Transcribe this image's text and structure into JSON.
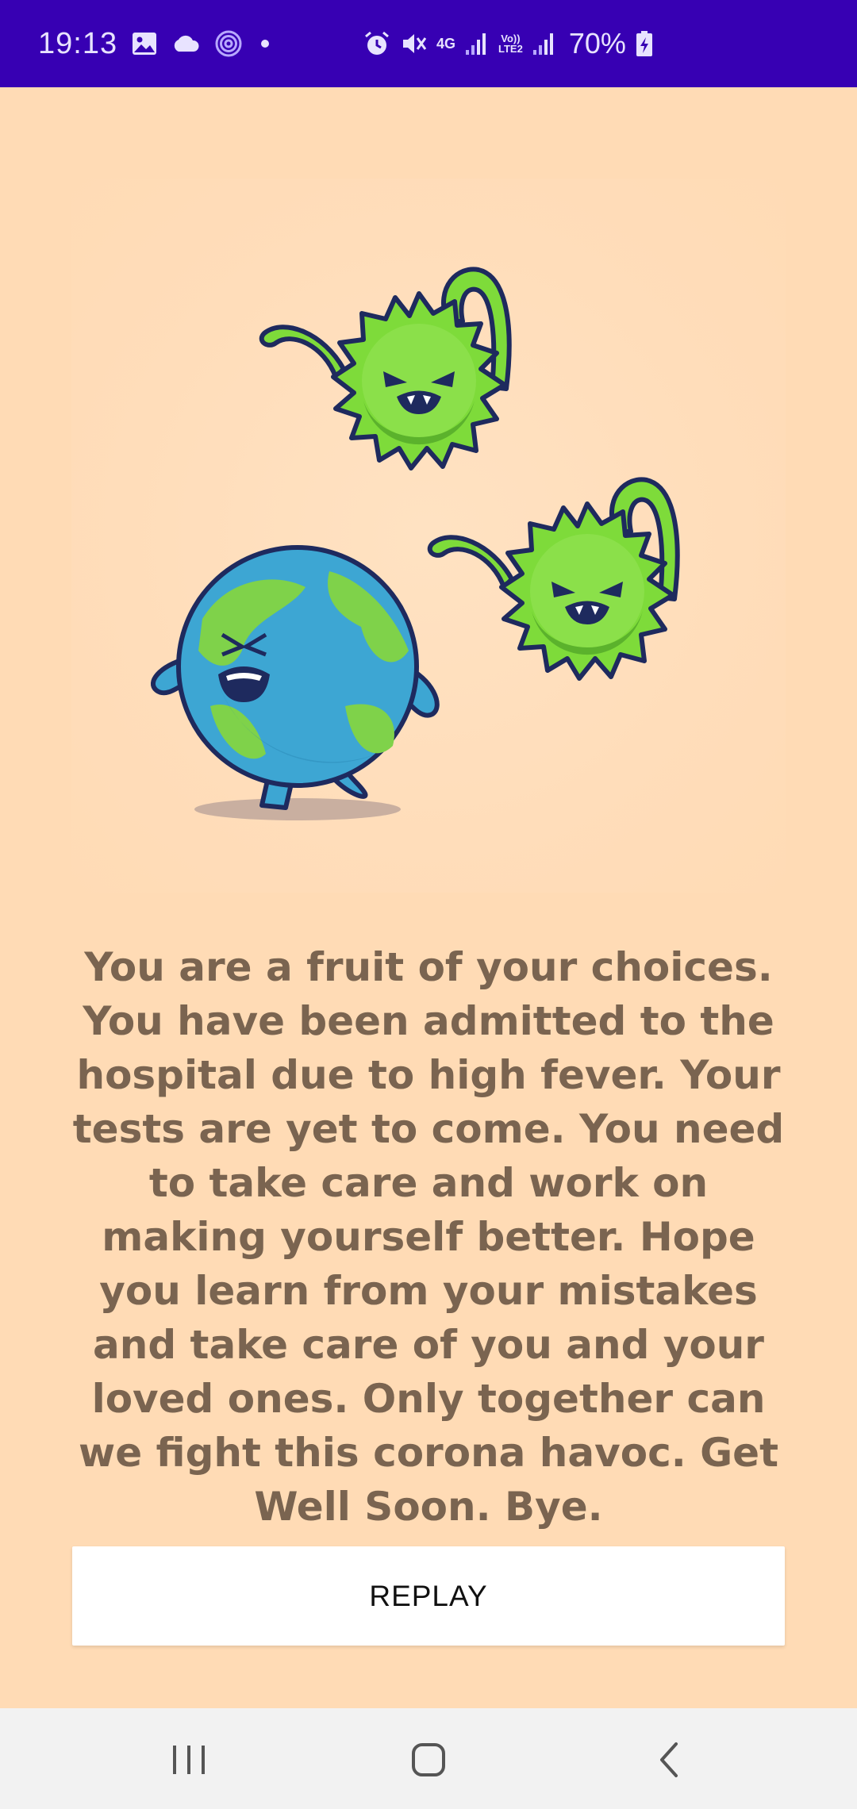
{
  "status_bar": {
    "time": "19:13",
    "network": "4G",
    "lte_label": "Vo))\nLTE2",
    "battery": "70%",
    "icons": [
      "gallery-icon",
      "cloud-icon",
      "hotspot-icon",
      "dot-icon",
      "alarm-icon",
      "mute-icon",
      "signal-icon",
      "battery-charging-icon"
    ]
  },
  "illustration": {
    "icons": [
      "virus-icon",
      "earth-icon",
      "virus-icon"
    ]
  },
  "message": {
    "text": "You are a fruit of your choices. You have been admitted to the hospital due to high fever. Your tests are yet to come. You need to take care and work on making yourself better. Hope you learn from your mistakes and take care of you and your loved ones. Only together can we fight this corona havoc. Get Well Soon. Bye."
  },
  "replay_button": {
    "label": "REPLAY"
  },
  "nav_bar": {
    "icons": [
      "recent-apps-icon",
      "home-icon",
      "back-icon"
    ]
  },
  "colors": {
    "background": "#FFDBB5",
    "status_bar": "#3700B3",
    "text": "#7A6450",
    "button": "#FFFFFF"
  }
}
